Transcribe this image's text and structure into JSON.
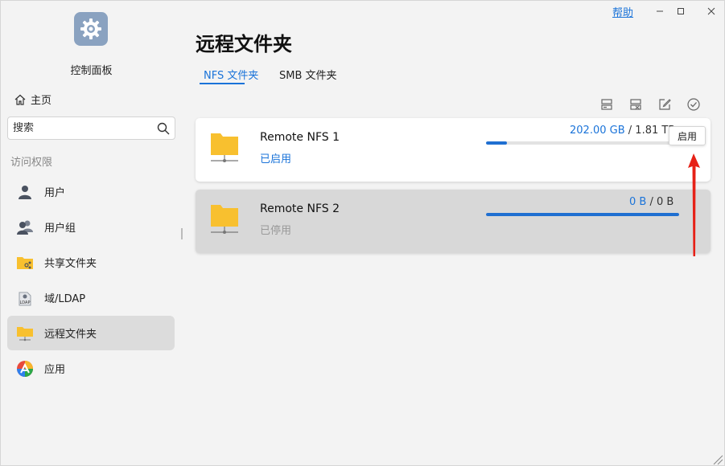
{
  "window": {
    "help_label": "帮助"
  },
  "sidebar": {
    "app_title": "控制面板",
    "home_label": "主页",
    "search_placeholder": "搜索",
    "section_label": "访问权限",
    "items": [
      {
        "label": "用户",
        "icon": "user-icon"
      },
      {
        "label": "用户组",
        "icon": "user-group-icon"
      },
      {
        "label": "共享文件夹",
        "icon": "shared-folder-icon"
      },
      {
        "label": "域/LDAP",
        "icon": "ldap-icon"
      },
      {
        "label": "远程文件夹",
        "icon": "remote-folder-icon",
        "active": true
      },
      {
        "label": "应用",
        "icon": "app-icon"
      }
    ]
  },
  "main": {
    "title": "远程文件夹",
    "tabs": [
      {
        "label": "NFS 文件夹",
        "active": true
      },
      {
        "label": "SMB 文件夹",
        "active": false
      }
    ],
    "toolbar": [
      "mount-icon",
      "unmount-icon",
      "edit-icon",
      "enable-check-icon"
    ],
    "folders": [
      {
        "name": "Remote NFS 1",
        "status": "已启用",
        "used": "202.00 GB",
        "separator": "/",
        "total": "1.81 TB",
        "fill_fraction": 0.11,
        "enabled": true
      },
      {
        "name": "Remote NFS 2",
        "status": "已停用",
        "used": "0 B",
        "separator": "/",
        "total": "0 B",
        "fill_fraction": 1.0,
        "enabled": false
      }
    ],
    "tooltip": "启用"
  },
  "colors": {
    "accent": "#1a73d9",
    "folder": "#f8c02f",
    "annotation_arrow": "#e62117"
  }
}
